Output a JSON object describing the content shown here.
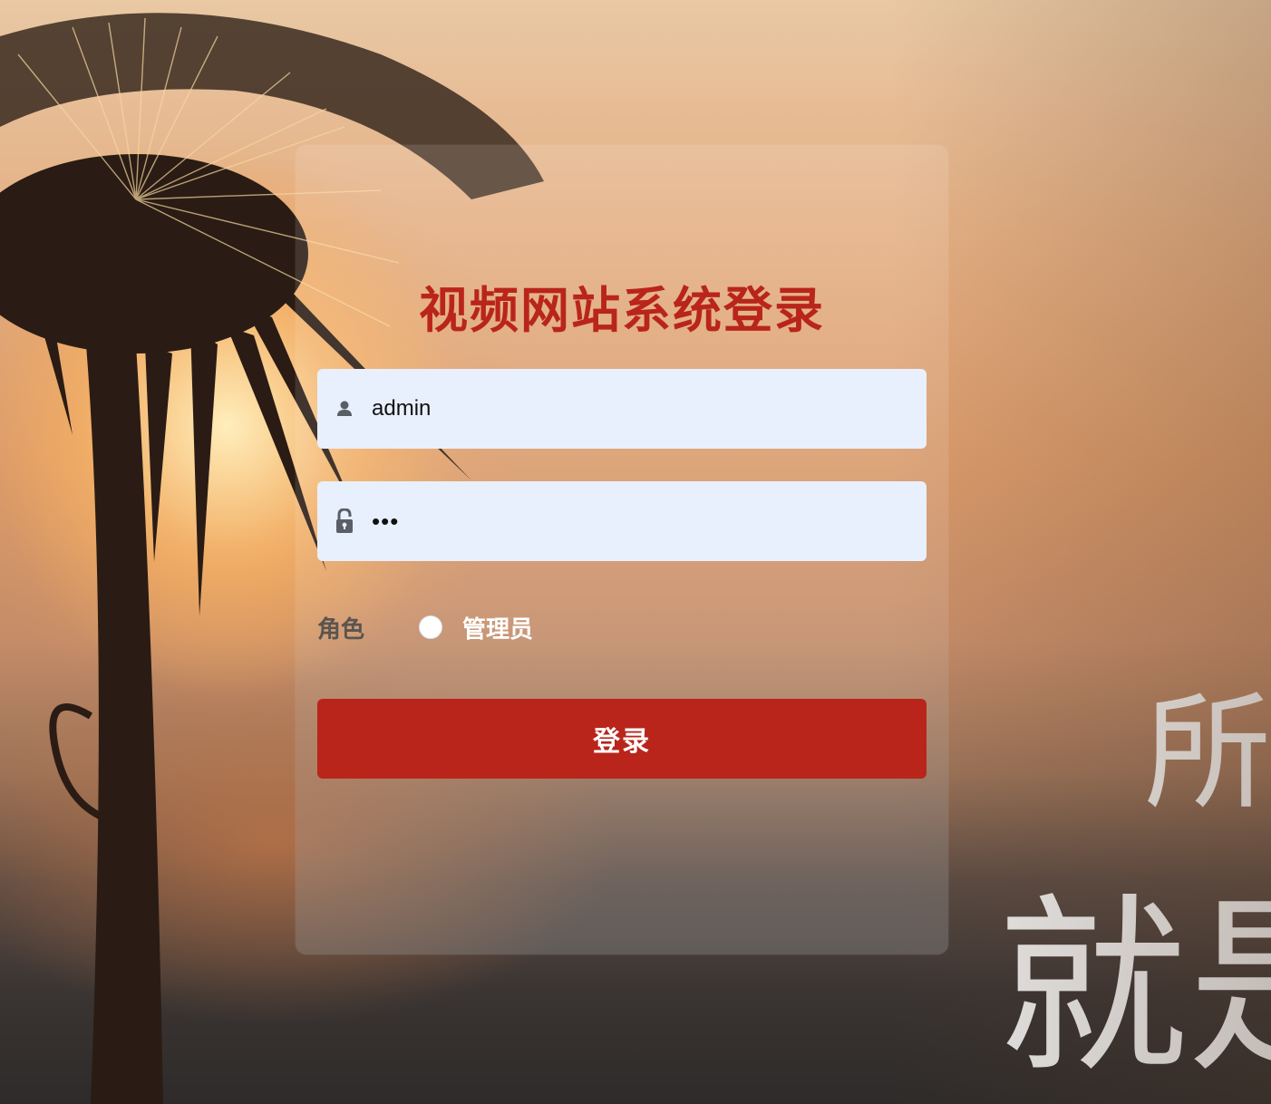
{
  "page": {
    "title": "视频网站系统登录"
  },
  "form": {
    "username_value": "admin",
    "password_value": "•••",
    "role_label": "角色",
    "role_option": "管理员",
    "submit_label": "登录"
  },
  "background": {
    "calligraphy_line1": "所",
    "calligraphy_line2": "就是"
  },
  "colors": {
    "accent": "#b9251b",
    "input_bg": "#e8f0fe"
  },
  "icons": {
    "username": "user-icon",
    "password": "lock-icon"
  }
}
